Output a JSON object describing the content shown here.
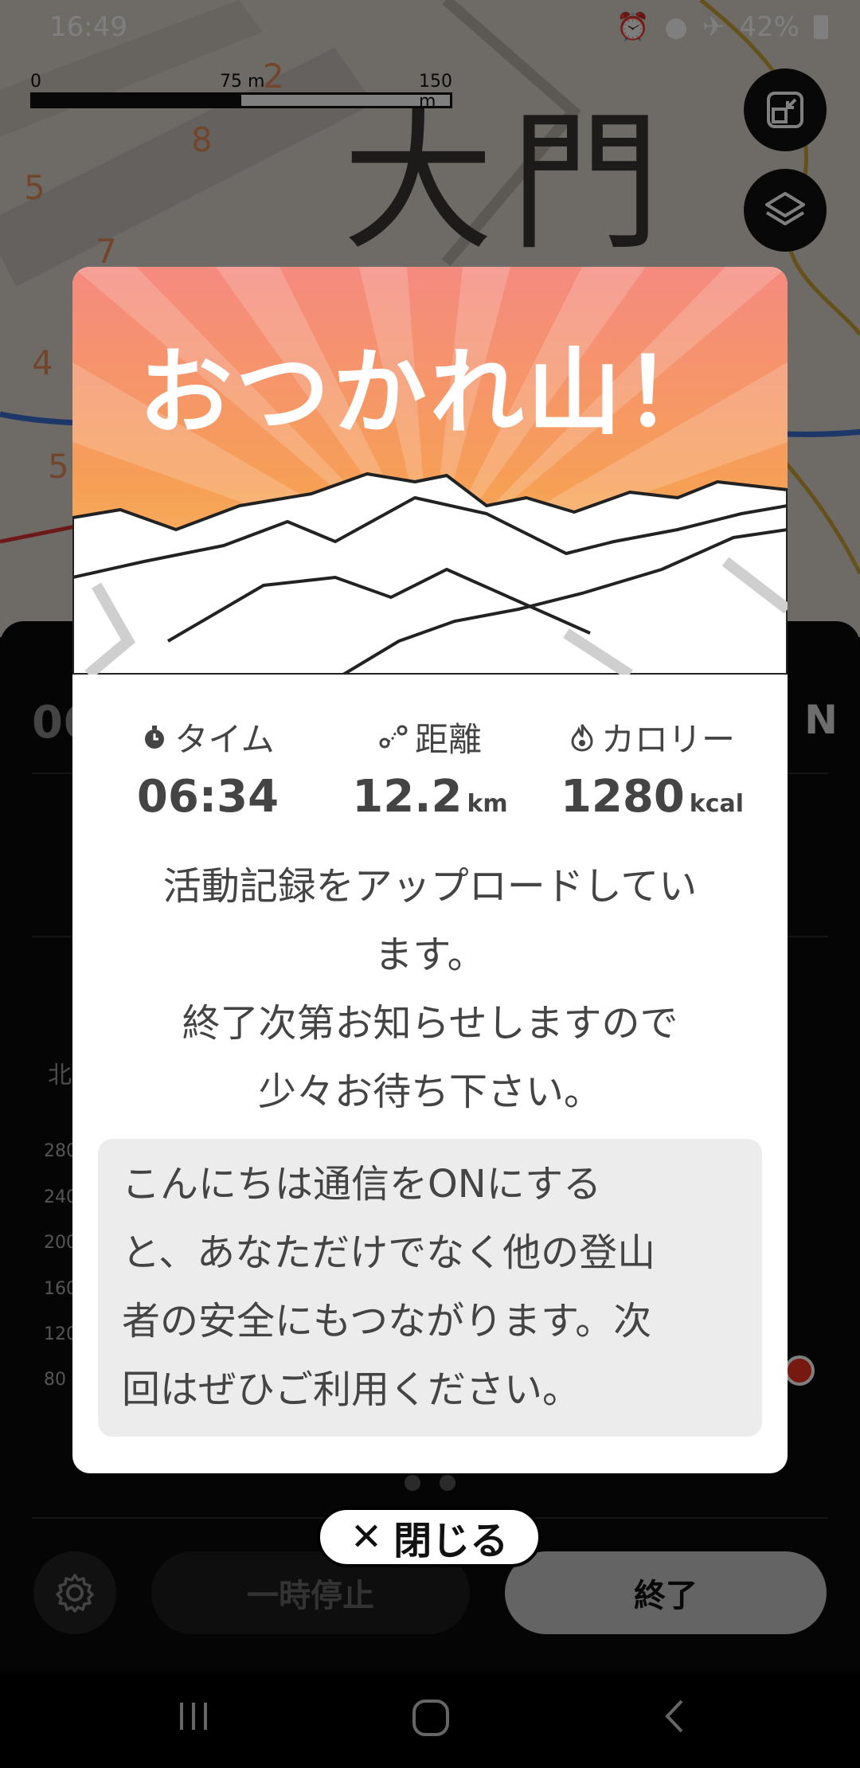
{
  "status_bar": {
    "time": "16:49",
    "battery": "42%"
  },
  "map": {
    "place_label": "大門",
    "scale": {
      "zero": "0",
      "mid": "75 m",
      "max": "150 m"
    }
  },
  "sheet": {
    "time_partial": "06",
    "north_partial": "北",
    "compass_partial": "N",
    "elevation_ticks": [
      "280",
      "240",
      "200",
      "160",
      "120",
      "80"
    ],
    "pause_label": "一時停止",
    "end_label": "終了"
  },
  "modal": {
    "title": "おつかれ山！",
    "stats": [
      {
        "label": "タイム",
        "icon": "stopwatch-icon",
        "value": "06:34",
        "unit": ""
      },
      {
        "label": "距離",
        "icon": "route-icon",
        "value": "12.2",
        "unit": "km"
      },
      {
        "label": "カロリー",
        "icon": "flame-icon",
        "value": "1280",
        "unit": "kcal"
      }
    ],
    "message_line1": "活動記録をアップロードしてい",
    "message_line2": "ます。",
    "message_line3": "終了次第お知らせしますので",
    "message_line4": "少々お待ち下さい。",
    "notice_line1": "こんにちは通信をONにする",
    "notice_line2": "と、あなただけでなく他の登山",
    "notice_line3": "者の安全にもつながります。次",
    "notice_line4": "回はぜひご利用ください。",
    "header_gradient": [
      "#f58a80",
      "#f6a055",
      "#ffd070"
    ]
  },
  "close_button": {
    "icon": "✕",
    "label": "閉じる"
  }
}
